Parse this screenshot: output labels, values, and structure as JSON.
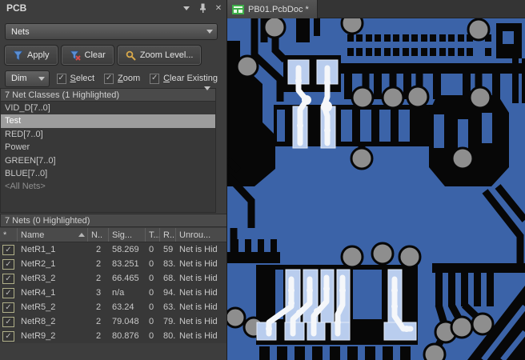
{
  "colors": {
    "board_blue": "#3b63a8",
    "board_black": "#070707",
    "pad_gray": "#8e8e8e",
    "highlight_pad": "#b9cdee",
    "highlight_trace": "#f5f7fa",
    "selection_bg": "#9c9c9c",
    "apply_funnel_blue": "#5b8fd4",
    "clear_x_red": "#d34c4c",
    "zoom_magnifier_gold": "#d9a94a",
    "doc_icon_green": "#3fae49",
    "checkbox_khaki": "#b0b089"
  },
  "panel": {
    "title": "PCB",
    "mode_select": {
      "value": "Nets"
    },
    "toolbar": {
      "apply": "Apply",
      "clear": "Clear",
      "zoom_level": "Zoom Level..."
    },
    "dim_select": {
      "value": "Dim"
    },
    "checkboxes": [
      {
        "label": "Select",
        "checked": true
      },
      {
        "label": "Zoom",
        "checked": true
      },
      {
        "label": "Clear Existing",
        "checked": true
      }
    ],
    "net_classes": {
      "header": "7 Net Classes (1 Highlighted)",
      "items": [
        {
          "label": "VID_D[7..0]",
          "selected": false
        },
        {
          "label": "Test",
          "selected": true
        },
        {
          "label": "RED[7..0]",
          "selected": false
        },
        {
          "label": "Power",
          "selected": false
        },
        {
          "label": "GREEN[7..0]",
          "selected": false
        },
        {
          "label": "BLUE[7..0]",
          "selected": false
        },
        {
          "label": "<All Nets>",
          "selected": false
        }
      ]
    },
    "nets": {
      "header": "7 Nets (0 Highlighted)",
      "columns": [
        "*",
        "Name",
        "N..",
        "Sig...",
        "T...",
        "R...",
        "Unrou..."
      ],
      "rows": [
        {
          "checked": true,
          "name": "NetR1_1",
          "n": "2",
          "sig": "58.269",
          "t": "0",
          "r": "59",
          "unrouted": "Net is Hid"
        },
        {
          "checked": true,
          "name": "NetR2_1",
          "n": "2",
          "sig": "83.251",
          "t": "0",
          "r": "83.",
          "unrouted": "Net is Hid"
        },
        {
          "checked": true,
          "name": "NetR3_2",
          "n": "2",
          "sig": "66.465",
          "t": "0",
          "r": "68.",
          "unrouted": "Net is Hid"
        },
        {
          "checked": true,
          "name": "NetR4_1",
          "n": "3",
          "sig": "n/a",
          "t": "0",
          "r": "94.",
          "unrouted": "Net is Hid"
        },
        {
          "checked": true,
          "name": "NetR5_2",
          "n": "2",
          "sig": "63.24",
          "t": "0",
          "r": "63.",
          "unrouted": "Net is Hid"
        },
        {
          "checked": true,
          "name": "NetR8_2",
          "n": "2",
          "sig": "79.048",
          "t": "0",
          "r": "79.",
          "unrouted": "Net is Hid"
        },
        {
          "checked": true,
          "name": "NetR9_2",
          "n": "2",
          "sig": "80.876",
          "t": "0",
          "r": "80.",
          "unrouted": "Net is Hid"
        }
      ]
    }
  },
  "editor": {
    "tab": {
      "label": "PB01.PcbDoc *"
    }
  }
}
